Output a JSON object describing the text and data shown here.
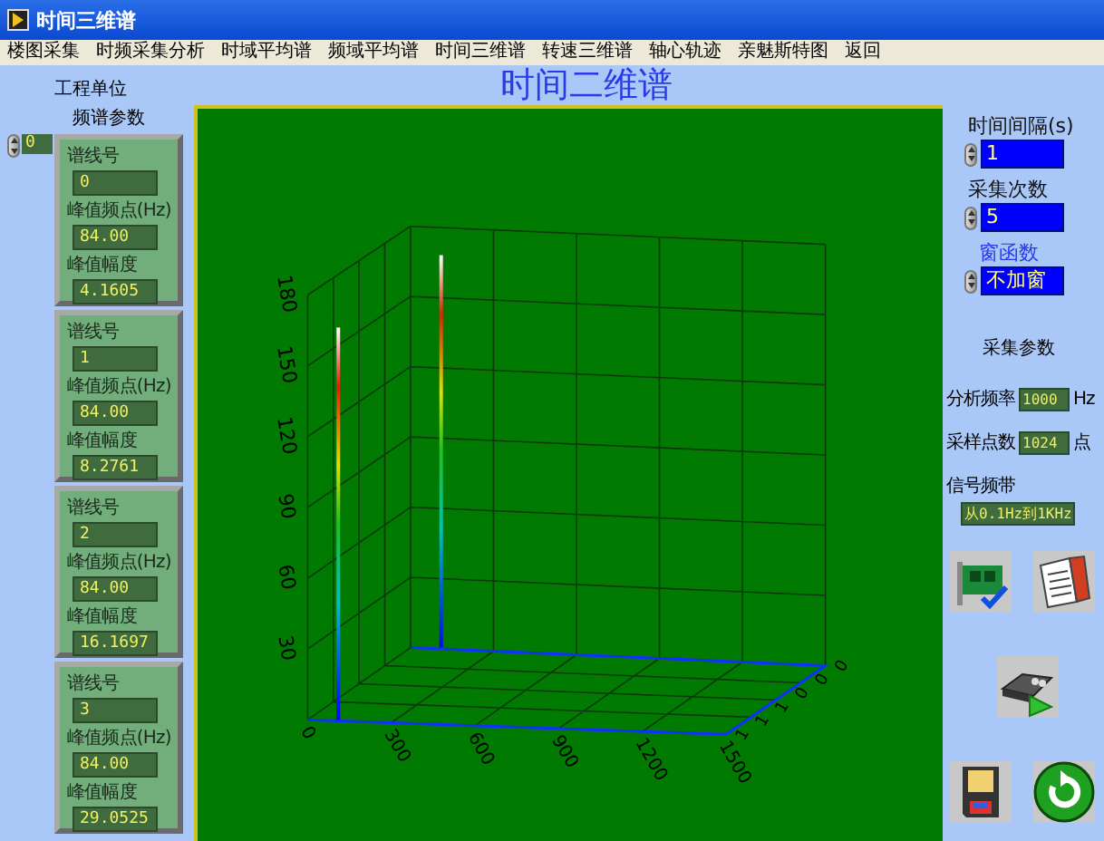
{
  "window": {
    "title": "时间三维谱"
  },
  "menu": [
    "楼图采集",
    "时频采集分析",
    "时域平均谱",
    "频域平均谱",
    "时间三维谱",
    "转速三维谱",
    "轴心轨迹",
    "亲魅斯特图",
    "返回"
  ],
  "heading": "时间二维谱",
  "left_panel": {
    "unit_label": "工程单位",
    "section_label": "频谱参数",
    "index": "0",
    "cards": [
      {
        "line_label": "谱线号",
        "line_value": "0",
        "freq_label": "峰值频点(Hz)",
        "freq_value": "84.00",
        "amp_label": "峰值幅度",
        "amp_value": "4.1605"
      },
      {
        "line_label": "谱线号",
        "line_value": "1",
        "freq_label": "峰值频点(Hz)",
        "freq_value": "84.00",
        "amp_label": "峰值幅度",
        "amp_value": "8.2761"
      },
      {
        "line_label": "谱线号",
        "line_value": "2",
        "freq_label": "峰值频点(Hz)",
        "freq_value": "84.00",
        "amp_label": "峰值幅度",
        "amp_value": "16.1697"
      },
      {
        "line_label": "谱线号",
        "line_value": "3",
        "freq_label": "峰值频点(Hz)",
        "freq_value": "84.00",
        "amp_label": "峰值幅度",
        "amp_value": "29.0525"
      }
    ]
  },
  "chart": {
    "z_ticks": [
      "180",
      "150",
      "120",
      "90",
      "60",
      "30"
    ],
    "x_ticks": [
      "0",
      "300",
      "600",
      "900",
      "1200",
      "1500"
    ],
    "depth_ticks": [
      "1",
      "1",
      "1",
      "0",
      "0",
      "0"
    ]
  },
  "right_panel": {
    "interval_label": "时间间隔(s)",
    "interval_value": "1",
    "count_label": "采集次数",
    "count_value": "5",
    "window_label": "窗函数",
    "window_value": "不加窗",
    "params_label": "采集参数",
    "rate_label": "分析频率",
    "rate_value": "1000",
    "rate_unit": "Hz",
    "points_label": "采样点数",
    "points_value": "1024",
    "points_unit": "点",
    "band_label": "信号频带",
    "band_value": "从0.1Hz到1KHz"
  }
}
